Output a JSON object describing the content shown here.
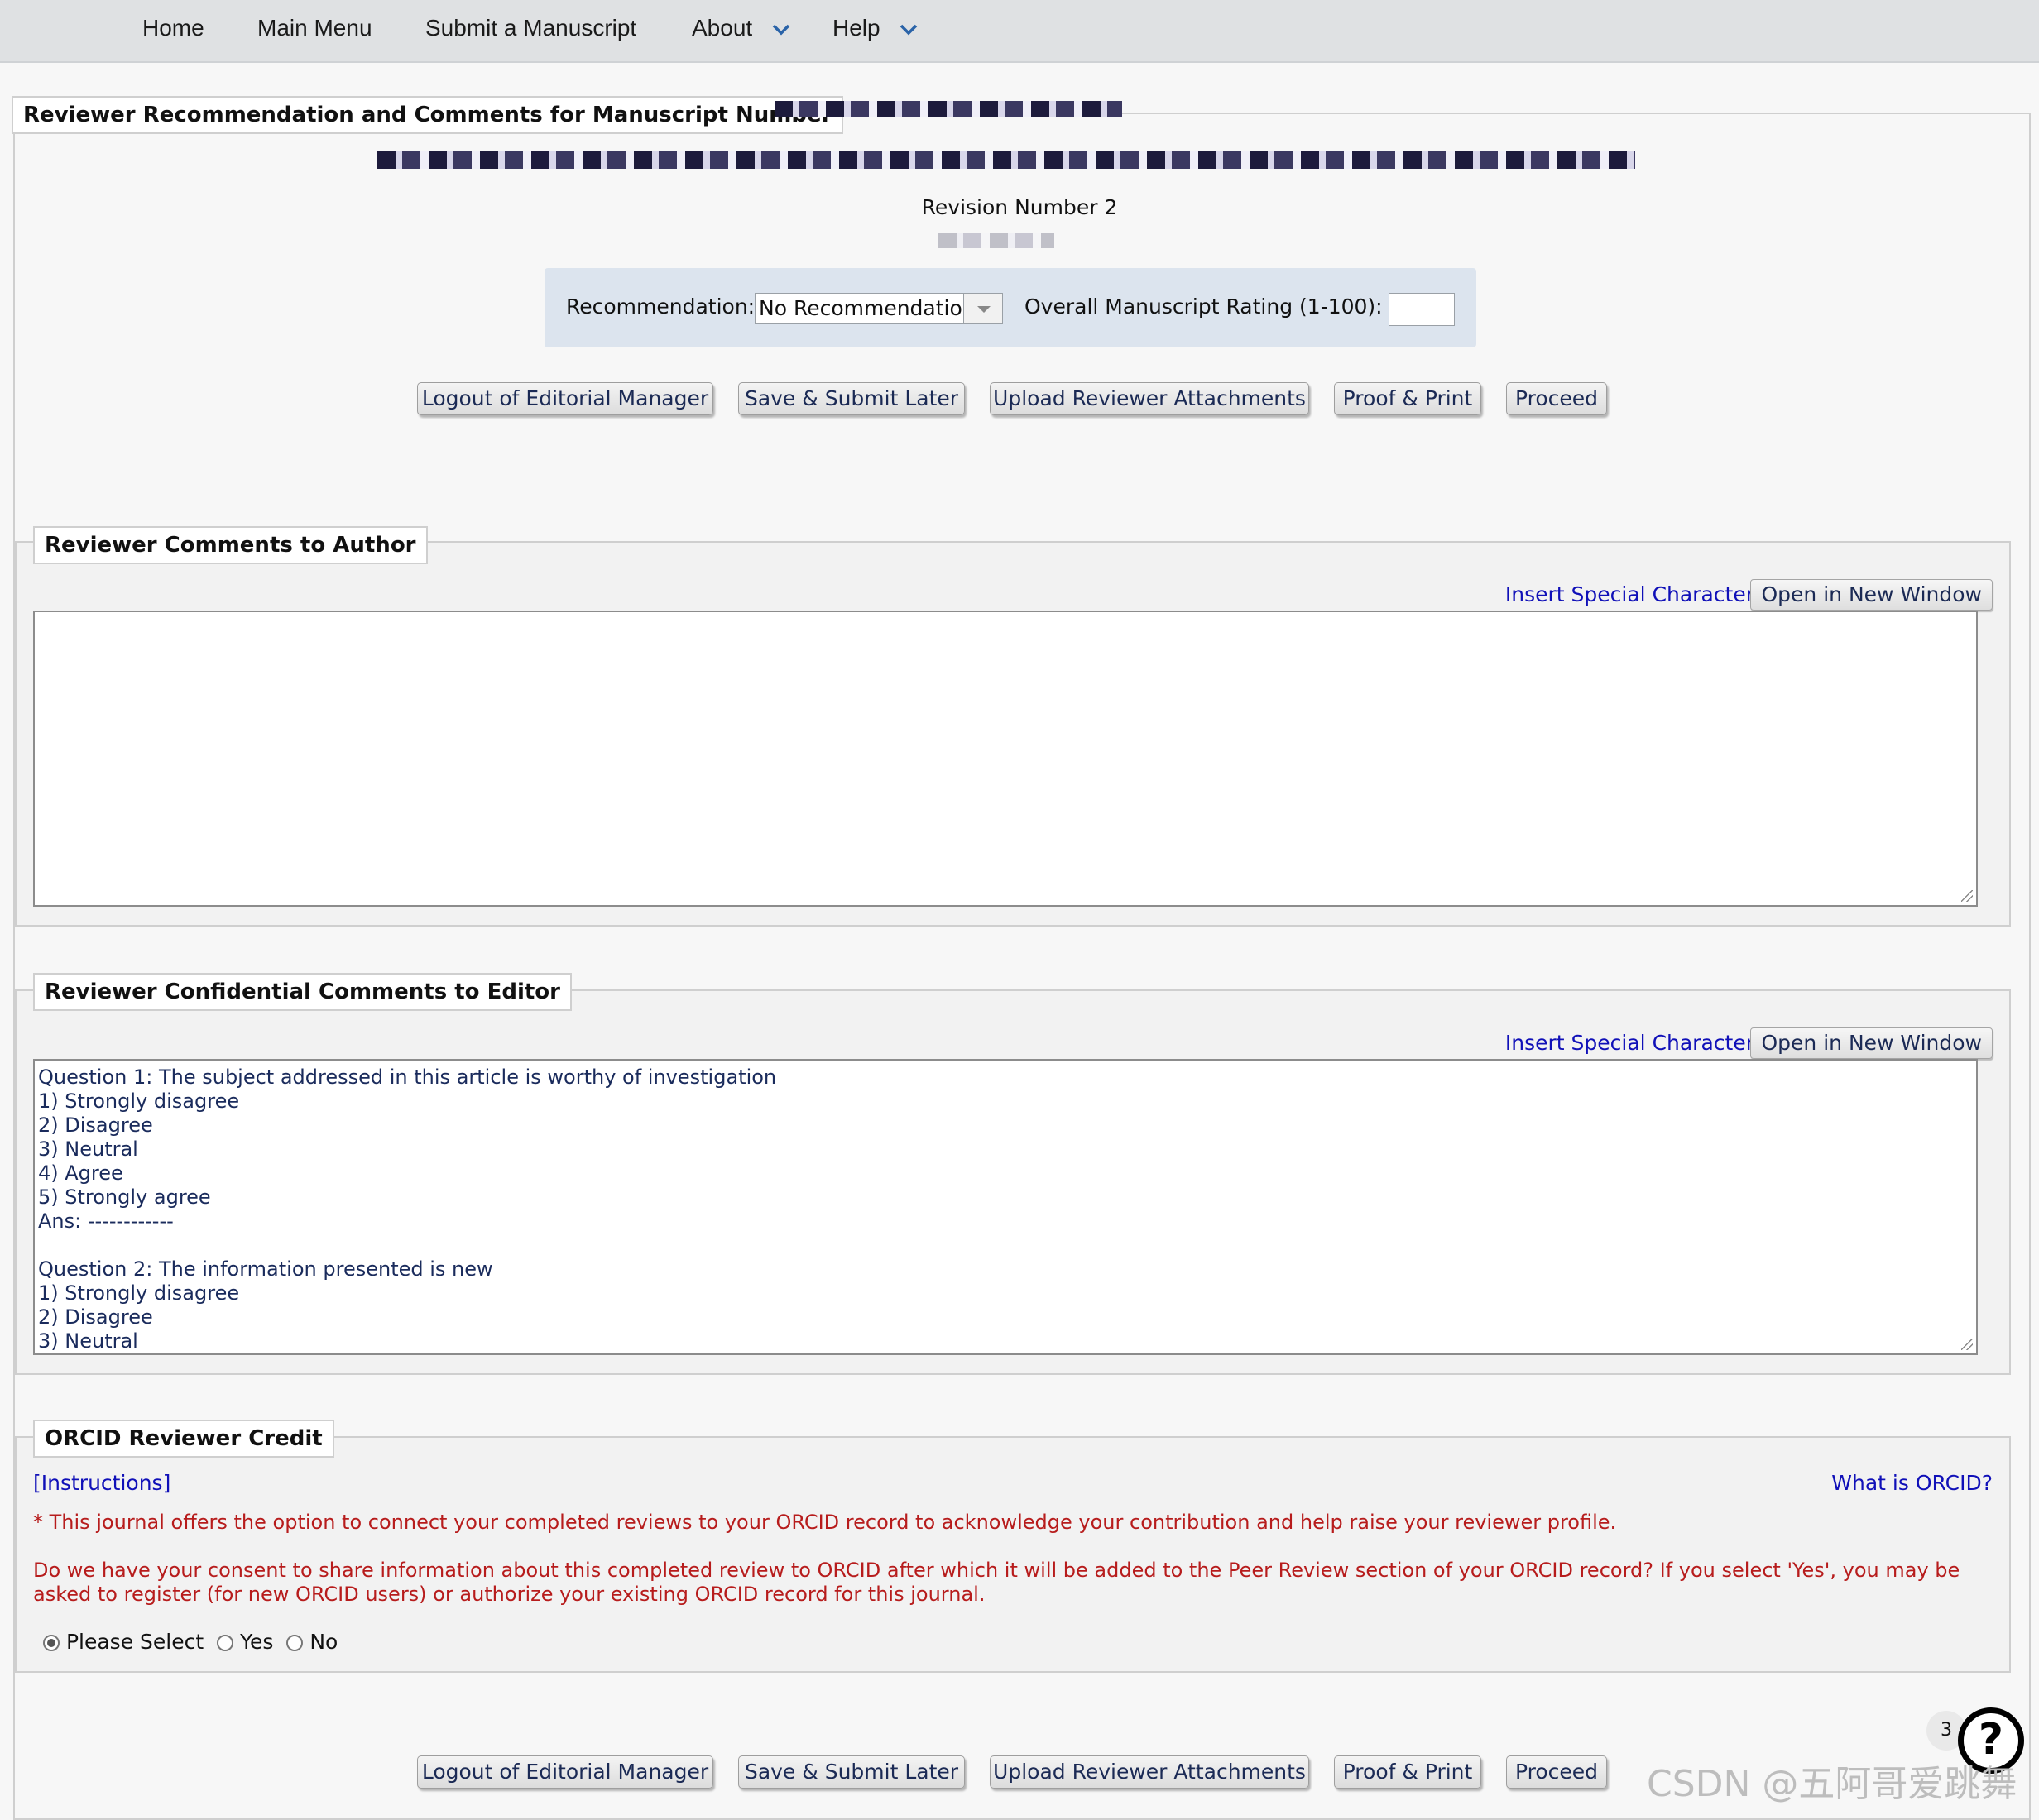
{
  "nav": {
    "home": "Home",
    "main_menu": "Main Menu",
    "submit": "Submit a Manuscript",
    "about": "About",
    "help": "Help"
  },
  "header": {
    "title": "Reviewer Recommendation and Comments for Manuscript Number",
    "revision": "Revision Number 2"
  },
  "recommendation": {
    "label": "Recommendation:",
    "selected": "No Recommendation",
    "rating_label": "Overall Manuscript Rating (1-100):",
    "rating_value": ""
  },
  "buttons": {
    "logout": "Logout of Editorial Manager",
    "save": "Save & Submit Later",
    "upload": "Upload Reviewer Attachments",
    "proof": "Proof & Print",
    "proceed": "Proceed"
  },
  "author_section": {
    "title": "Reviewer Comments to Author",
    "insert_char": "Insert Special Character",
    "open_window": "Open in New Window",
    "text": ""
  },
  "editor_section": {
    "title": "Reviewer Confidential Comments to Editor",
    "insert_char": "Insert Special Character",
    "open_window": "Open in New Window",
    "lines": [
      "Question 1: The subject addressed in this article is worthy of investigation",
      "1) Strongly disagree",
      "2) Disagree",
      "3) Neutral",
      "4) Agree",
      "5) Strongly agree",
      "Ans: ------------",
      "",
      "Question 2: The information presented is new",
      "1) Strongly disagree",
      "2) Disagree",
      "3) Neutral"
    ]
  },
  "orcid": {
    "title": "ORCID Reviewer Credit",
    "instructions": "[Instructions]",
    "what_is": "What is ORCID?",
    "note": "* This journal offers the option to connect your completed reviews to your ORCID record to acknowledge your contribution and help raise your reviewer profile.",
    "consent_line1": "Do we have your consent to share information about this completed review to ORCID after which it will be added to the Peer Review section of your ORCID record? If you select 'Yes', you may be",
    "consent_line2": "asked to register (for new ORCID users) or authorize your existing ORCID record for this journal.",
    "options": [
      "Please Select",
      "Yes",
      "No"
    ],
    "selected": "Please Select"
  },
  "help_widget": {
    "badge": "3",
    "symbol": "?"
  },
  "watermark": "CSDN @五阿哥爱跳舞",
  "colors": {
    "link": "#1010b8",
    "warning": "#b71c1c",
    "nav_bg": "#dfe1e3",
    "rec_bg": "#dce4ee"
  }
}
